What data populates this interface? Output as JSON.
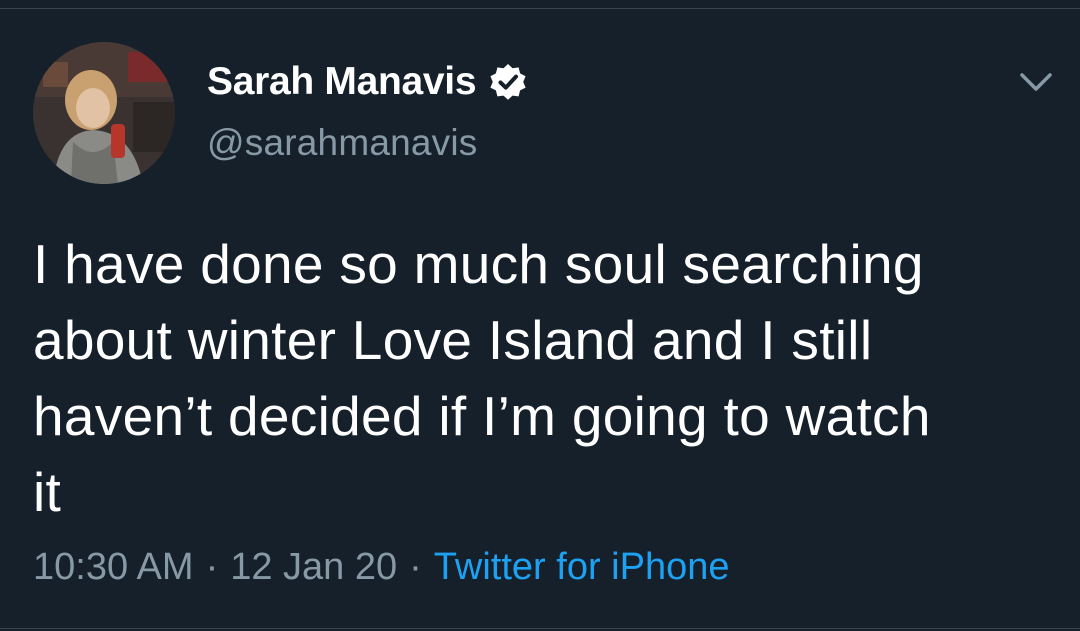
{
  "tweet": {
    "author": {
      "display_name": "Sarah Manavis",
      "handle": "@sarahmanavis",
      "verified": true,
      "avatar": "profile-photo"
    },
    "text": "I have done so much soul searching\nabout winter Love Island and I still\nhaven’t decided if I’m going to watch\nit",
    "time": "10:30 AM",
    "separator": "·",
    "date": "12 Jan 20",
    "source": "Twitter for iPhone"
  },
  "icons": {
    "verified": "verified-badge-icon",
    "more": "chevron-down-icon"
  },
  "colors": {
    "background": "#15202b",
    "primary_text": "#ffffff",
    "secondary_text": "#8899a6",
    "link": "#1da1f2",
    "border": "#38444d"
  }
}
